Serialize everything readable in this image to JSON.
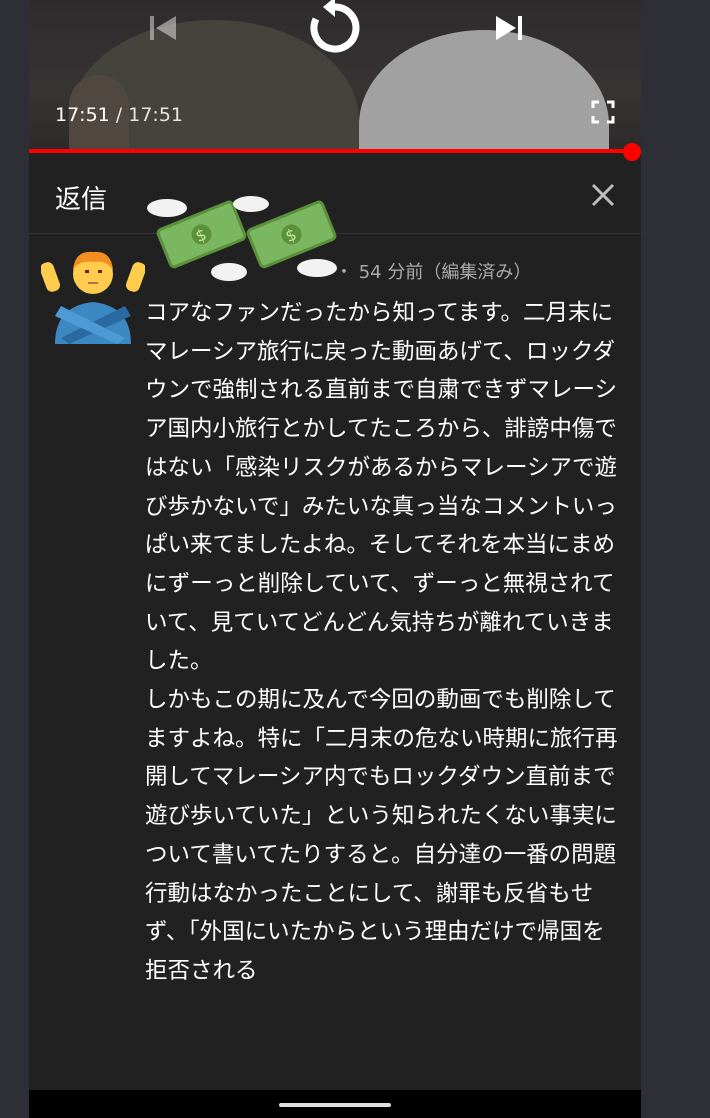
{
  "player": {
    "current_time": "17:51",
    "separator": " / ",
    "total_time": "17:51",
    "progress_fraction": 1.0,
    "icons": [
      "previous-icon",
      "replay-icon",
      "next-icon",
      "fullscreen-icon"
    ]
  },
  "reply_panel": {
    "title": "返信",
    "close_icon": "close-icon"
  },
  "comment": {
    "author": "",
    "meta": "・ 54 分前（編集済み）",
    "body": "コアなファンだったから知ってます。二月末にマレーシア旅行に戻った動画あげて、ロックダウンで強制される直前まで自粛できずマレーシア国内小旅行とかしてたころから、誹謗中傷ではない「感染リスクがあるからマレーシアで遊び歩かないで」みたいな真っ当なコメントいっぱい来てましたよね。そしてそれを本当にまめにずーっと削除していて、ずーっと無視されていて、見ていてどんどん気持ちが離れていきました。\nしかもこの期に及んで今回の動画でも削除してますよね。特に「二月末の危ない時期に旅行再開してマレーシア内でもロックダウン直前まで遊び歩いていた」という知られたくない事実について書いてたりすると。自分達の一番の問題行動はなかったことにして、謝罪も反省もせず、「外国にいたからという理由だけで帰国を拒否される"
  },
  "colors": {
    "panel_bg": "#212121",
    "accent_red": "#ff0000",
    "text_primary": "#ffffff",
    "text_secondary": "#aaaaaa"
  }
}
